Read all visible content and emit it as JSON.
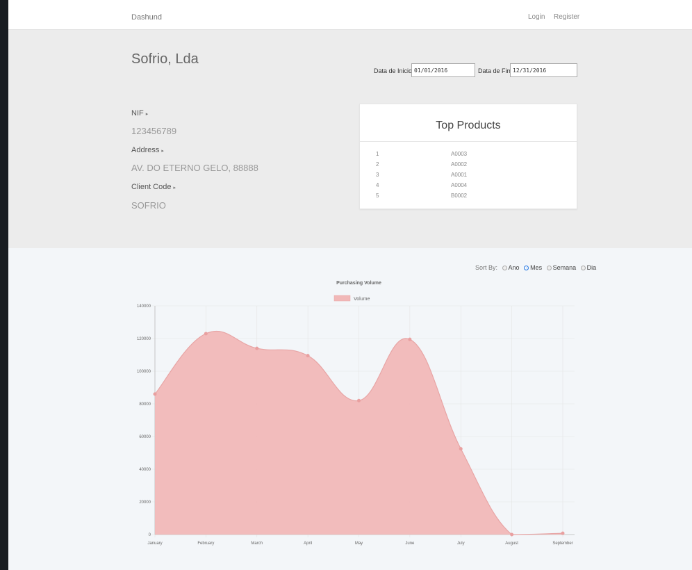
{
  "navbar": {
    "brand": "Dashund",
    "login": "Login",
    "register": "Register"
  },
  "client": {
    "name": "Sofrio, Lda",
    "nif_label": "NIF",
    "nif_value": "123456789",
    "address_label": "Address",
    "address_value": "AV. DO ETERNO GELO, 88888",
    "client_code_label": "Client Code",
    "client_code_value": "SOFRIO"
  },
  "filters": {
    "start_label": "Data de Inicio:",
    "start_value": "01/01/2016",
    "end_label": "Data de Fim:",
    "end_value": "12/31/2016"
  },
  "top_products": {
    "title": "Top Products",
    "items": [
      {
        "rank": "1",
        "code": "A0003"
      },
      {
        "rank": "2",
        "code": "A0002"
      },
      {
        "rank": "3",
        "code": "A0001"
      },
      {
        "rank": "4",
        "code": "A0004"
      },
      {
        "rank": "5",
        "code": "B0002"
      }
    ]
  },
  "sort": {
    "label": "Sort By:",
    "options": [
      "Ano",
      "Mes",
      "Semana",
      "Dia"
    ],
    "selected": "Mes"
  },
  "chart_data": {
    "type": "area",
    "title": "Purchasing Volume",
    "categories": [
      "January",
      "February",
      "March",
      "April",
      "May",
      "June",
      "July",
      "August",
      "September"
    ],
    "series": [
      {
        "name": "Volume",
        "values": [
          86000,
          123000,
          114000,
          109500,
          82000,
          119500,
          52500,
          0,
          800
        ],
        "color": "#f1b8b8",
        "line_color": "#e8a5a5"
      }
    ],
    "ylim": [
      0,
      140000
    ],
    "yticks": [
      0,
      20000,
      40000,
      60000,
      80000,
      100000,
      120000,
      140000
    ],
    "legend_position": "top",
    "grid": true
  },
  "colors": {
    "nav_bg": "#ffffff",
    "hero_bg": "#ececec",
    "content_bg": "#f3f6f9",
    "frame_bg": "#181c21",
    "radio_selected": "#2a7ae2"
  }
}
